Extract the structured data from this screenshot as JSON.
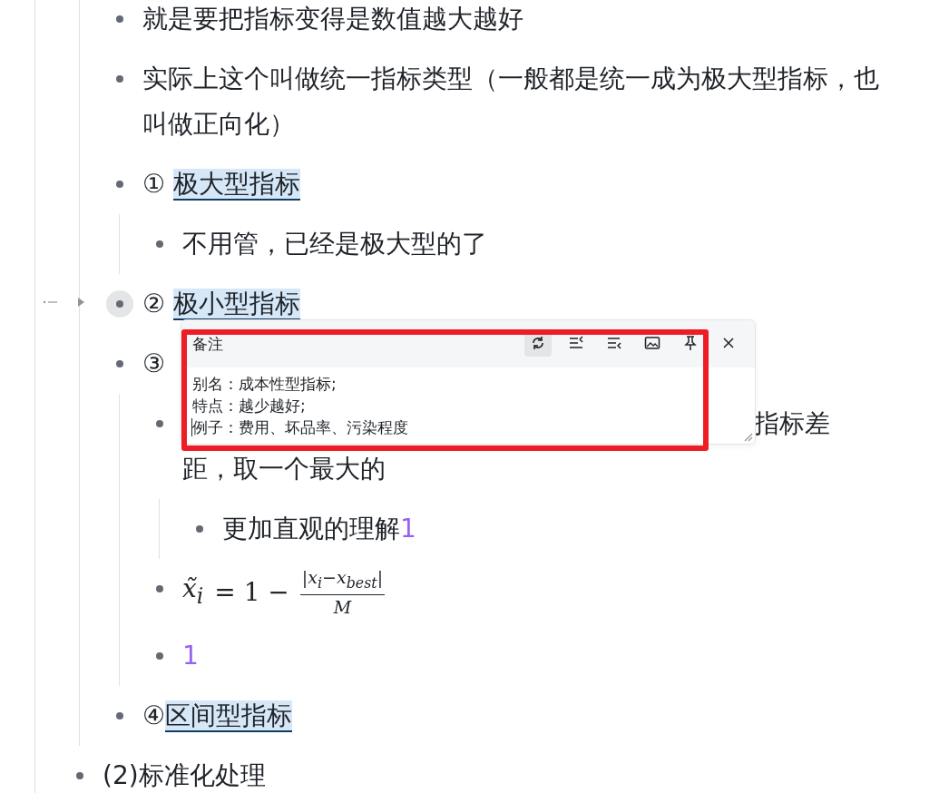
{
  "outline": {
    "items": [
      {
        "children": [
          {
            "text": "就是要把指标变得是数值越大越好"
          },
          {
            "text": "实际上这个叫做统一指标类型（一般都是统一成为极大型指标，也叫做正向化）"
          },
          {
            "prefix": "① ",
            "highlight": "极大型指标",
            "children": [
              {
                "text": "不用管，已经是极大型的了"
              }
            ]
          },
          {
            "prefix": "② ",
            "highlight": "极小型指标",
            "hovered": true,
            "collapsed": true,
            "note": {
              "title": "备注",
              "tools": [
                {
                  "kind": "refresh",
                  "selected": true
                },
                {
                  "kind": "list-left",
                  "selected": false
                },
                {
                  "kind": "list-right",
                  "selected": false
                },
                {
                  "kind": "image",
                  "selected": false
                },
                {
                  "kind": "pin",
                  "selected": false
                }
              ],
              "lines": [
                "别名：成本性型指标;",
                "特点：越少越好;",
                "例子：费用、坏品率、污染程度"
              ],
              "annotation": {
                "kind": "rectangle",
                "color": "#ee1c25"
              }
            }
          },
          {
            "prefix": "③",
            "children": [
              {
                "kind": "covered",
                "tail": "指标差",
                "text": "距，取一个最大的",
                "children": [
                  {
                    "text": "更加直观的理解",
                    "ref": "1"
                  }
                ]
              },
              {
                "kind": "formula",
                "lhs": "x̃$_{i}$",
                "middle": "= 1 −",
                "numerator": "|x$_{i}$−x$_{best}$|",
                "denominator": "M"
              },
              {
                "ref": "1"
              }
            ]
          },
          {
            "prefix": "④",
            "highlight": "区间型指标"
          }
        ]
      },
      {
        "text": "(2)标准化处理"
      }
    ]
  }
}
